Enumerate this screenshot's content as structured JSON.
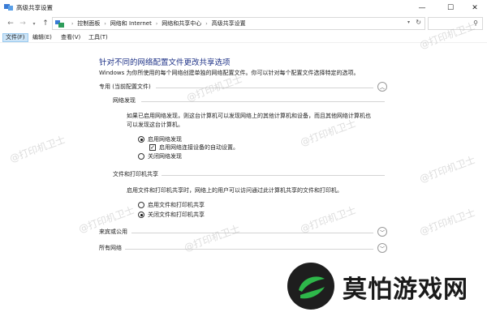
{
  "window": {
    "title": "高级共享设置",
    "minimize": "—",
    "maximize": "☐",
    "close": "✕"
  },
  "address": {
    "crumbs": [
      "控制面板",
      "网络和 Internet",
      "网络和共享中心",
      "高级共享设置"
    ],
    "separator": "›",
    "icons": [
      "back-arrow-icon",
      "forward-arrow-icon",
      "dropdown-icon",
      "up-arrow-icon",
      "control-panel-icon",
      "refresh-icon",
      "search-icon"
    ]
  },
  "menu": {
    "file": "文件(F)",
    "edit": "编辑(E)",
    "view": "查看(V)",
    "tools": "工具(T)"
  },
  "content": {
    "heading": "针对不同的网络配置文件更改共享选项",
    "subtext": "Windows 为你所使用的每个网络创建单独的网络配置文件。你可以针对每个配置文件选择特定的选项。",
    "private": {
      "label": "专用 (当前配置文件)",
      "discovery": {
        "label": "网络发现",
        "desc1": "如果已启用网络发现，则这台计算机可以发现网络上的其他计算机和设备，而且其他网络计算机也",
        "desc2": "可以发现这台计算机。",
        "opt_on": "启用网络发现",
        "opt_auto": "启用网络连接设备的自动设置。",
        "opt_off": "关闭网络发现"
      },
      "sharing": {
        "label": "文件和打印机共享",
        "desc": "启用文件和打印机共享时，网络上的用户可以访问通过此计算机共享的文件和打印机。",
        "opt_on": "启用文件和打印机共享",
        "opt_off": "关闭文件和打印机共享"
      }
    },
    "guest": {
      "label": "来宾或公用"
    },
    "all": {
      "label": "所有网络"
    }
  },
  "watermark": "@打印机卫士",
  "logo": {
    "text": "莫怕游戏网"
  }
}
